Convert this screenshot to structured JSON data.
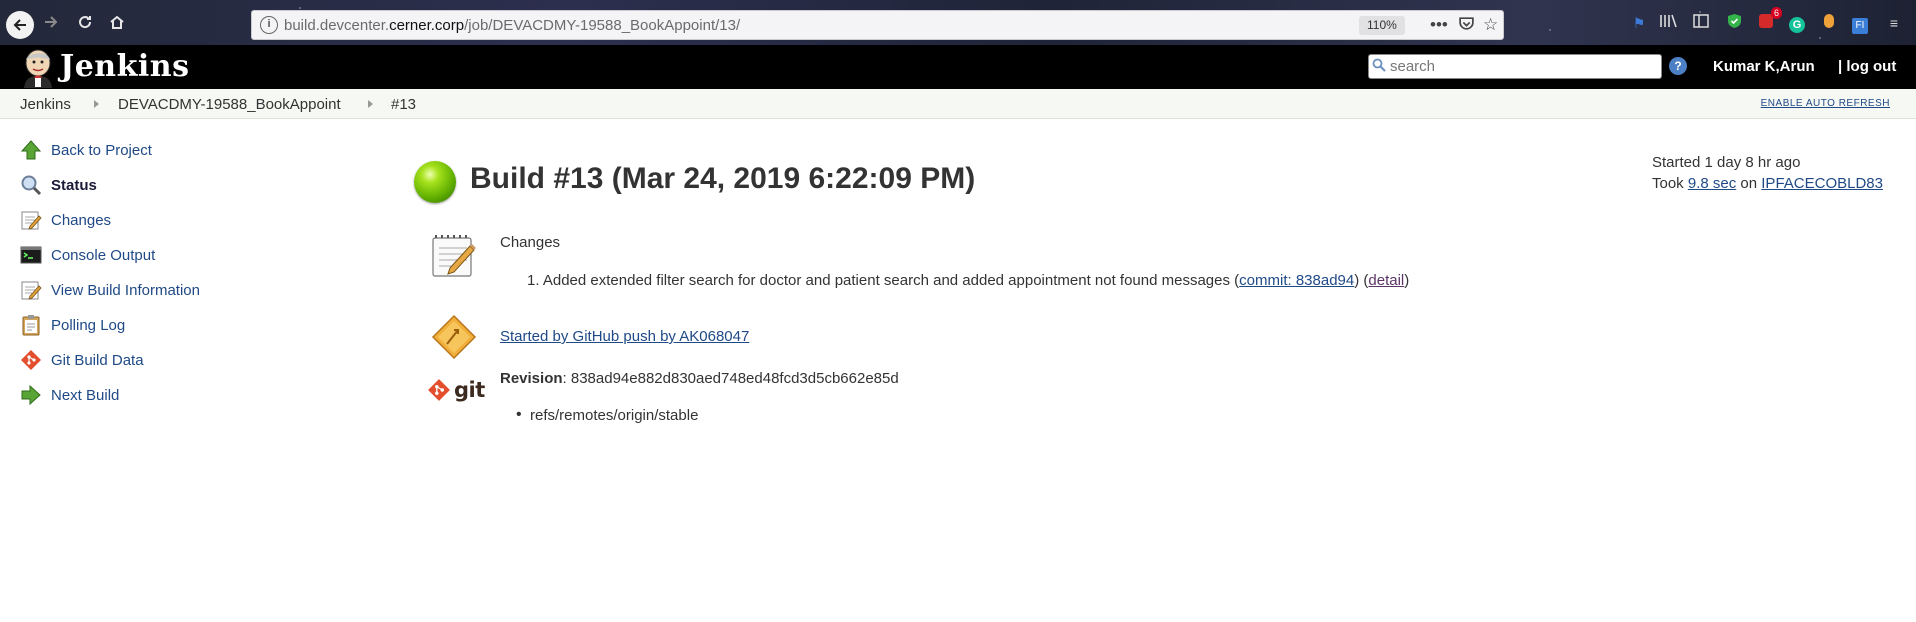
{
  "browser": {
    "url_prefix": "build.devcenter.",
    "url_domain": "cerner.corp",
    "url_path": "/job/DEVACDMY-19588_BookAppoint/13/",
    "zoom": "110%",
    "extension_badge": "6"
  },
  "header": {
    "title": "Jenkins",
    "search_placeholder": "search",
    "help": "?",
    "user": "Kumar K,Arun",
    "logout": "| log out"
  },
  "breadcrumb": {
    "items": [
      "Jenkins",
      "DEVACDMY-19588_BookAppoint",
      "#13"
    ],
    "auto_refresh": "ENABLE AUTO REFRESH"
  },
  "sidebar": {
    "items": [
      {
        "label": "Back to Project",
        "icon": "up-arrow-icon"
      },
      {
        "label": "Status",
        "icon": "magnifier-icon"
      },
      {
        "label": "Changes",
        "icon": "notepad-icon"
      },
      {
        "label": "Console Output",
        "icon": "terminal-icon"
      },
      {
        "label": "View Build Information",
        "icon": "notepad-icon"
      },
      {
        "label": "Polling Log",
        "icon": "clipboard-icon"
      },
      {
        "label": "Git Build Data",
        "icon": "git-icon"
      },
      {
        "label": "Next Build",
        "icon": "right-arrow-icon"
      }
    ]
  },
  "build": {
    "title": "Build #13 (Mar 24, 2019 6:22:09 PM)",
    "status_color": "#62b000",
    "started": "Started 1 day 8 hr ago",
    "took_prefix": "Took ",
    "duration": "9.8 sec",
    "took_mid": " on ",
    "node": "IPFACECOBLD83"
  },
  "changes": {
    "heading": "Changes",
    "item_number": "1.",
    "item_text": "Added extended filter search for doctor and patient search and added appointment not found messages (",
    "commit": "commit: 838ad94",
    "between": ") (",
    "detail": "detail",
    "end": ")"
  },
  "cause": {
    "label": "Started by GitHub push by AK068047"
  },
  "git": {
    "logo_text": "git",
    "revision_label": "Revision",
    "revision_value": ": 838ad94e882d830aed748ed48fcd3d5cb662e85d",
    "ref": "refs/remotes/origin/stable"
  }
}
